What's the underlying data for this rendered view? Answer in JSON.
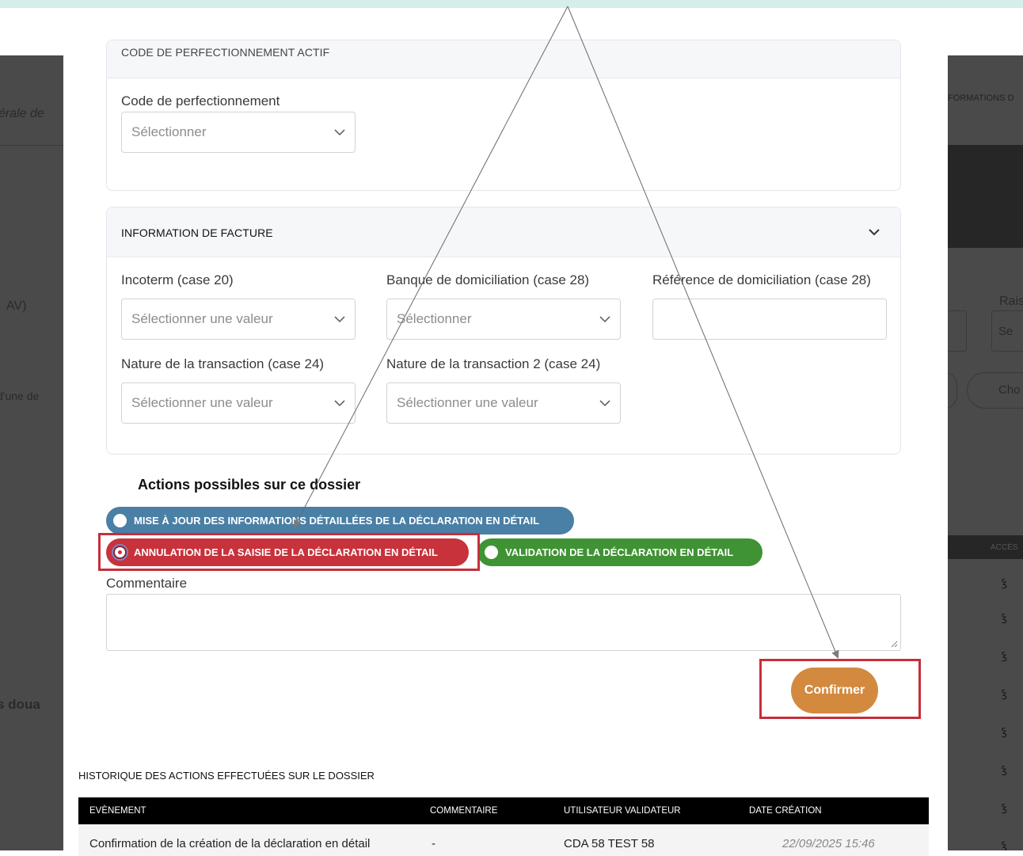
{
  "background": {
    "left_fragments": [
      "érale de",
      "AV)",
      "d'une de",
      "s doua"
    ],
    "right_fragments": [
      "FORMATIONS D",
      "Rais",
      "Se",
      "Cho",
      "ACCÈS"
    ],
    "row_icon": "flow-icon"
  },
  "sections": {
    "partial_header": "CODE DE PERFECTIONNEMENT ACTIF",
    "perfectionnement": {
      "label": "Code de perfectionnement",
      "placeholder": "Sélectionner"
    },
    "facture": {
      "title": "INFORMATION DE FACTURE",
      "fields": [
        {
          "label": "Incoterm (case 20)",
          "placeholder": "Sélectionner une valeur"
        },
        {
          "label": "Banque de domiciliation (case 28)",
          "placeholder": "Sélectionner"
        },
        {
          "label": "Référence de domiciliation (case 28)",
          "value": ""
        },
        {
          "label": "Nature de la transaction (case 24)",
          "placeholder": "Sélectionner une valeur"
        },
        {
          "label": "Nature de la transaction 2 (case 24)",
          "placeholder": "Sélectionner une valeur"
        }
      ]
    }
  },
  "actions": {
    "title": "Actions possibles sur ce dossier",
    "options": [
      {
        "label": "MISE À JOUR DES INFORMATIONS DÉTAILLÉES DE LA DÉCLARATION EN DÉTAIL",
        "color": "#4a7fa6",
        "selected": false
      },
      {
        "label": "ANNULATION DE LA SAISIE DE LA DÉCLARATION EN DÉTAIL",
        "color": "#c8323b",
        "selected": true
      },
      {
        "label": "VALIDATION DE LA DÉCLARATION EN DÉTAIL",
        "color": "#3f9334",
        "selected": false
      }
    ],
    "comment_label": "Commentaire",
    "comment_value": "",
    "confirm_label": "Confirmer",
    "confirm_color": "#d38a3f"
  },
  "history": {
    "title": "HISTORIQUE DES ACTIONS EFFECTUÉES SUR LE DOSSIER",
    "columns": [
      "EVÈNEMENT",
      "COMMENTAIRE",
      "UTILISATEUR VALIDATEUR",
      "DATE CRÉATION"
    ],
    "rows": [
      [
        "Confirmation de la création de la déclaration en détail",
        "-",
        "CDA 58 TEST 58",
        "22/09/2025 15:46"
      ]
    ]
  },
  "annotation_color": "#c62f3a"
}
